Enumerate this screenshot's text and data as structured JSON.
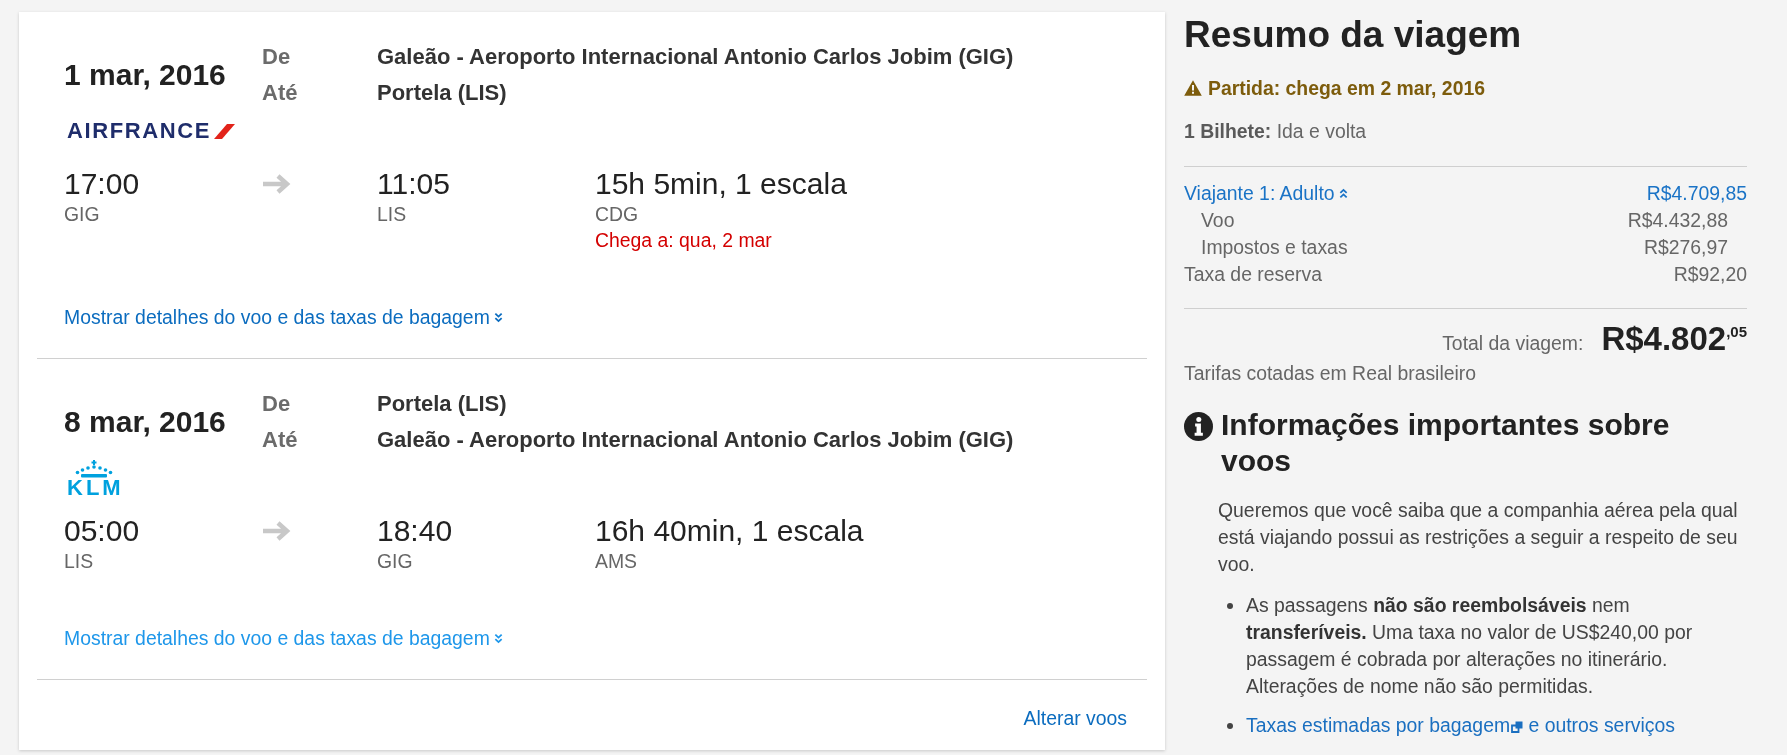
{
  "flights": [
    {
      "date": "1 mar, 2016",
      "from_label": "De",
      "from": "Galeão - Aeroporto Internacional Antonio Carlos Jobim (GIG)",
      "to_label": "Até",
      "to": "Portela (LIS)",
      "logo": {
        "kind": "slash",
        "text": "AIRFRANCE"
      },
      "departure": {
        "time": "17:00",
        "code": "GIG"
      },
      "arrival": {
        "time": "11:05",
        "code": "LIS"
      },
      "duration": "15h 5min, 1 escala",
      "stop": "CDG",
      "notice": "Chega a: qua, 2 mar",
      "details_link": {
        "text": "Mostrar detalhes do voo e das taxas de bagagem",
        "hovered": false
      }
    },
    {
      "date": "8 mar, 2016",
      "from_label": "De",
      "from": "Portela (LIS)",
      "to_label": "Até",
      "to": "Galeão - Aeroporto Internacional Antonio Carlos Jobim (GIG)",
      "logo": {
        "kind": "crown",
        "text": "KLM"
      },
      "departure": {
        "time": "05:00",
        "code": "LIS"
      },
      "arrival": {
        "time": "18:40",
        "code": "GIG"
      },
      "duration": "16h 40min, 1 escala",
      "stop": "AMS",
      "details_link": {
        "text": "Mostrar detalhes do voo e das taxas de bagagem",
        "hovered": true
      }
    }
  ],
  "change_link": "Alterar voos",
  "summary": {
    "title": "Resumo da viagem",
    "warning": "Partida: chega em 2 mar, 2016",
    "tickets": "**1 Bilhete:** Ida e volta",
    "price_lines": [
      {
        "kind": "toggle",
        "label": "Viajante 1: Adulto",
        "amount": "R$4.709,85",
        "expanded": true,
        "children": [
          {
            "label": "Voo",
            "amount": "R$4.432,88"
          },
          {
            "label": "Impostos e taxas",
            "amount": "R$276,97"
          }
        ]
      },
      {
        "kind": "plain",
        "label": "Taxa de reserva",
        "amount": "R$92,20"
      }
    ],
    "total": {
      "label": "Total da viagem:",
      "amount": "R$4.802$^{,05}$"
    },
    "currency_note": "Tarifas cotadas em Real brasileiro"
  },
  "important_info": {
    "title": "Informações importantes sobre voos",
    "intro": "Queremos que você saiba que a companhia aérea pela qual está viajando possui as restrições a seguir a respeito de seu voo.",
    "items": [
      {
        "kind": "text",
        "text": "As passagens **não são reembolsáveis** nem **transferíveis.** Uma taxa no valor de US$240,00 por passagem é cobrada por alterações no itinerário. Alterações de nome não são permitidas."
      },
      {
        "kind": "link",
        "link": "Taxas estimadas por bagagem",
        "text": "e outros serviços"
      }
    ]
  }
}
